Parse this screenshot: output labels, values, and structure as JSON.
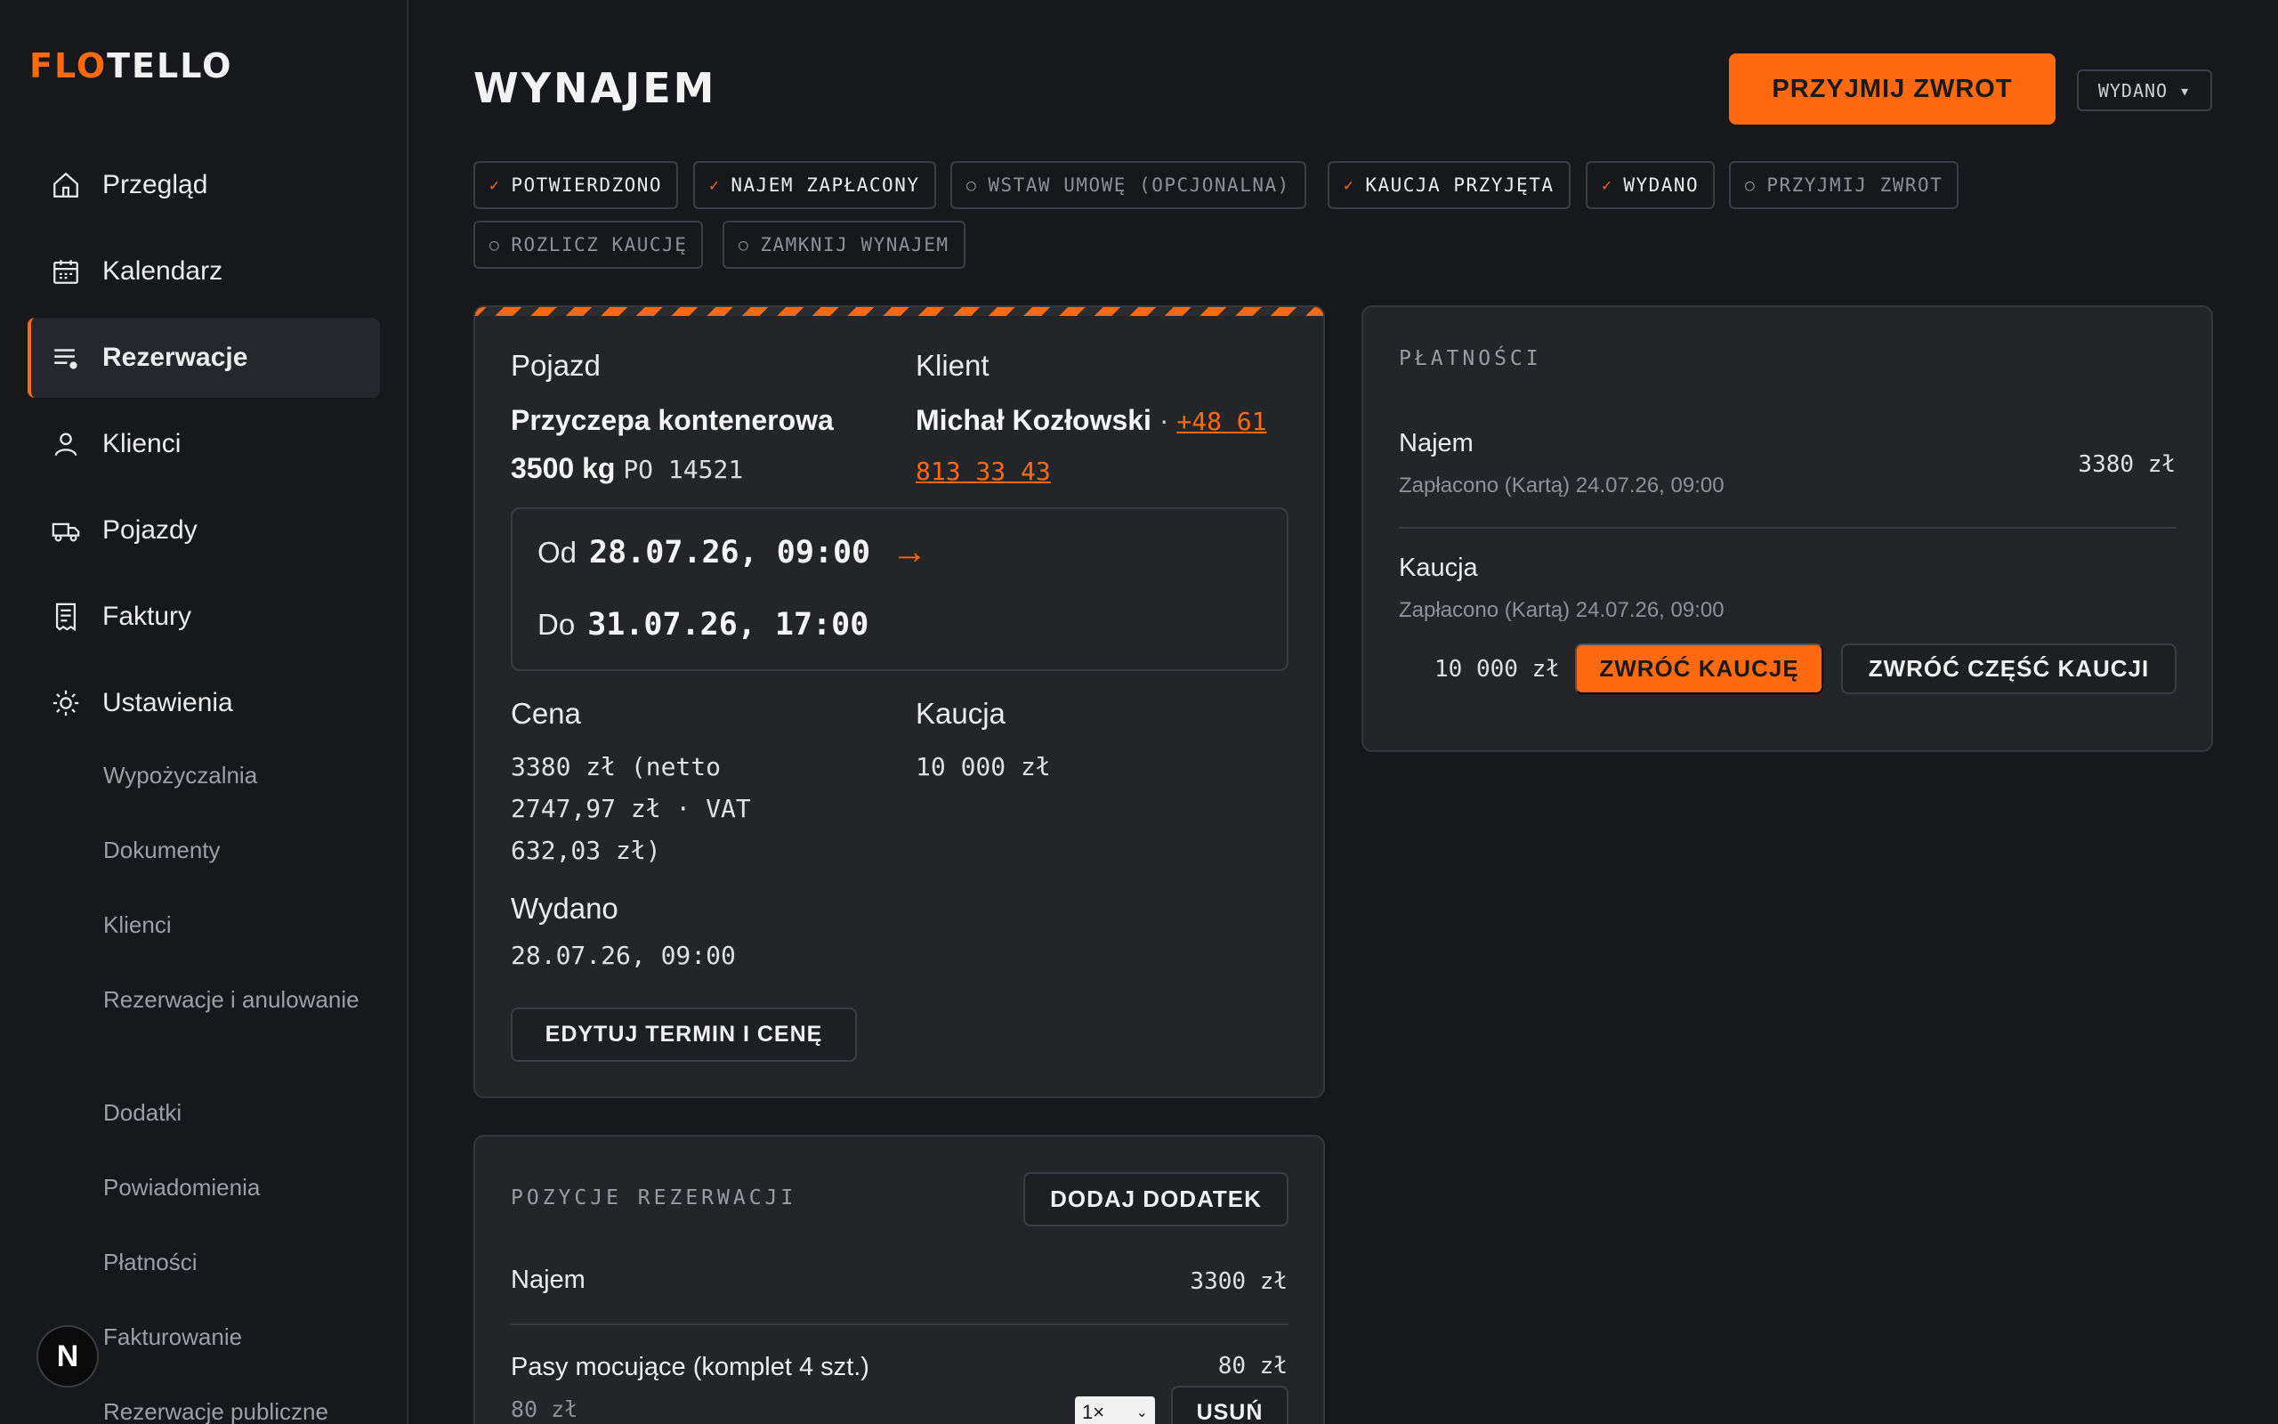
{
  "brand": {
    "logo_part1": "FLO",
    "logo_part2": "TELLO",
    "fab_letter": "N"
  },
  "sidebar": {
    "items": [
      {
        "label": "Przegląd",
        "icon": "home-icon"
      },
      {
        "label": "Kalendarz",
        "icon": "calendar-icon"
      },
      {
        "label": "Rezerwacje",
        "icon": "list-icon",
        "active": true
      },
      {
        "label": "Klienci",
        "icon": "user-icon"
      },
      {
        "label": "Pojazdy",
        "icon": "truck-icon"
      },
      {
        "label": "Faktury",
        "icon": "receipt-icon"
      },
      {
        "label": "Ustawienia",
        "icon": "gear-icon"
      }
    ],
    "subitems": [
      "Wypożyczalnia",
      "Dokumenty",
      "Klienci",
      "Rezerwacje i anulowanie",
      "Dodatki",
      "Powiadomienia",
      "Płatności",
      "Fakturowanie",
      "Rezerwacje publiczne"
    ]
  },
  "header": {
    "title": "WYNAJEM",
    "primary_action": "PRZYJMIJ ZWROT",
    "status_dropdown": "WYDANO ▾"
  },
  "steps": [
    {
      "label": "POTWIERDZONO",
      "done": true
    },
    {
      "label": "NAJEM ZAPŁACONY",
      "done": true
    },
    {
      "label": "WSTAW UMOWĘ (OPCJONALNA)",
      "done": false
    },
    {
      "label": "KAUCJA PRZYJĘTA",
      "done": true
    },
    {
      "label": "WYDANO",
      "done": true
    },
    {
      "label": "PRZYJMIJ ZWROT",
      "done": false
    },
    {
      "label": "ROZLICZ KAUCJĘ",
      "done": false
    },
    {
      "label": "ZAMKNIJ WYNAJEM",
      "done": false
    }
  ],
  "rental": {
    "vehicle_label": "Pojazd",
    "vehicle_name": "Przyczepa kontenerowa",
    "vehicle_weight": "3500 kg",
    "vehicle_plate": "PO 14521",
    "client_label": "Klient",
    "client_name": "Michał Kozłowski",
    "client_sep": "·",
    "client_phone_1": "+48 61",
    "client_phone_2": "813 33 43",
    "from_prefix": "Od",
    "from_value": "28.07.26, 09:00",
    "arrow": "→",
    "to_prefix": "Do",
    "to_value": "31.07.26, 17:00",
    "price_label": "Cena",
    "price_line1": "3380 zł (netto",
    "price_line2": "2747,97 zł · VAT",
    "price_line3": "632,03 zł)",
    "deposit_label": "Kaucja",
    "deposit_value": "10 000 zł",
    "issued_label": "Wydano",
    "issued_value": "28.07.26, 09:00",
    "edit_button": "EDYTUJ TERMIN I CENĘ"
  },
  "items_card": {
    "title": "POZYCJE REZERWACJI",
    "add_button": "DODAJ DODATEK",
    "rows": [
      {
        "name": "Najem",
        "amount": "3300 zł"
      },
      {
        "name": "Pasy mocujące (komplet 4 szt.)",
        "amount": "80 zł",
        "unit": "80 zł",
        "qty": "1×",
        "remove": "USUŃ"
      }
    ]
  },
  "payments": {
    "title": "PŁATNOŚCI",
    "rent_label": "Najem",
    "rent_status": "Zapłacono (Kartą) 24.07.26, 09:00",
    "rent_amount": "3380 zł",
    "deposit_label": "Kaucja",
    "deposit_status": "Zapłacono (Kartą) 24.07.26, 09:00",
    "deposit_amount": "10 000 zł",
    "return_deposit": "ZWRÓĆ KAUCJĘ",
    "return_part": "ZWRÓĆ CZĘŚĆ KAUCJI"
  },
  "colors": {
    "accent": "#ff6a10",
    "background": "#17181b",
    "card": "#232529"
  }
}
